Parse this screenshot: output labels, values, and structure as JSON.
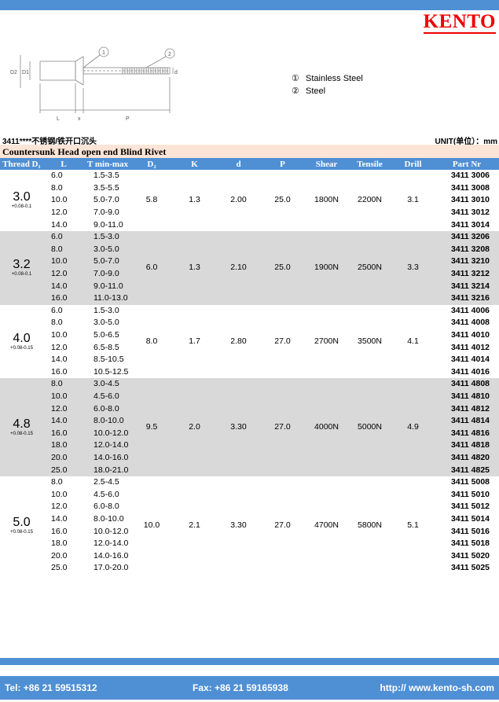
{
  "brand": "KENTO",
  "materials": [
    {
      "num": "①",
      "name": "Stainless Steel"
    },
    {
      "num": "②",
      "name": "Steel"
    }
  ],
  "drawing_labels": {
    "d2": "D2",
    "d1": "D1",
    "d": "d",
    "l": "L",
    "x": "x",
    "p": "P",
    "c1": "1",
    "c2": "2"
  },
  "product_line": "3411****不锈钢/铁开口沉头",
  "unit_label": "UNIT(单位）：mm",
  "subtitle": "Countersunk Head open end Blind Rivet",
  "headers": [
    "Thread D₁",
    "L",
    "T min-max",
    "D₂",
    "K",
    "d",
    "P",
    "Shear",
    "Tensile",
    "Drill",
    "Part Nr"
  ],
  "groups": [
    {
      "thread": "3.0",
      "tol": "+0.08-0.1",
      "d2": "5.8",
      "k": "1.3",
      "d": "2.00",
      "p": "25.0",
      "shear": "1800N",
      "tensile": "2200N",
      "drill": "3.1",
      "rows": [
        [
          "6.0",
          "1.5-3.5",
          "3411 3006"
        ],
        [
          "8.0",
          "3.5-5.5",
          "3411 3008"
        ],
        [
          "10.0",
          "5.0-7.0",
          "3411 3010"
        ],
        [
          "12.0",
          "7.0-9.0",
          "3411 3012"
        ],
        [
          "14.0",
          "9.0-11.0",
          "3411 3014"
        ]
      ]
    },
    {
      "thread": "3.2",
      "tol": "+0.08-0.1",
      "d2": "6.0",
      "k": "1.3",
      "d": "2.10",
      "p": "25.0",
      "shear": "1900N",
      "tensile": "2500N",
      "drill": "3.3",
      "rows": [
        [
          "6.0",
          "1.5-3.0",
          "3411 3206"
        ],
        [
          "8.0",
          "3.0-5.0",
          "3411 3208"
        ],
        [
          "10.0",
          "5.0-7.0",
          "3411 3210"
        ],
        [
          "12.0",
          "7.0-9.0",
          "3411 3212"
        ],
        [
          "14.0",
          "9.0-11.0",
          "3411 3214"
        ],
        [
          "16.0",
          "11.0-13.0",
          "3411 3216"
        ]
      ]
    },
    {
      "thread": "4.0",
      "tol": "+0.08-0.15",
      "d2": "8.0",
      "k": "1.7",
      "d": "2.80",
      "p": "27.0",
      "shear": "2700N",
      "tensile": "3500N",
      "drill": "4.1",
      "rows": [
        [
          "6.0",
          "1.5-3.0",
          "3411 4006"
        ],
        [
          "8.0",
          "3.0-5.0",
          "3411 4008"
        ],
        [
          "10.0",
          "5.0-6.5",
          "3411 4010"
        ],
        [
          "12.0",
          "6.5-8.5",
          "3411 4012"
        ],
        [
          "14.0",
          "8.5-10.5",
          "3411 4014"
        ],
        [
          "16.0",
          "10.5-12.5",
          "3411 4016"
        ]
      ]
    },
    {
      "thread": "4.8",
      "tol": "+0.08-0.15",
      "d2": "9.5",
      "k": "2.0",
      "d": "3.30",
      "p": "27.0",
      "shear": "4000N",
      "tensile": "5000N",
      "drill": "4.9",
      "rows": [
        [
          "8.0",
          "3.0-4.5",
          "3411 4808"
        ],
        [
          "10.0",
          "4.5-6.0",
          "3411 4810"
        ],
        [
          "12.0",
          "6.0-8.0",
          "3411 4812"
        ],
        [
          "14.0",
          "8.0-10.0",
          "3411 4814"
        ],
        [
          "16.0",
          "10.0-12.0",
          "3411 4816"
        ],
        [
          "18.0",
          "12.0-14.0",
          "3411 4818"
        ],
        [
          "20.0",
          "14.0-16.0",
          "3411 4820"
        ],
        [
          "25.0",
          "18.0-21.0",
          "3411 4825"
        ]
      ]
    },
    {
      "thread": "5.0",
      "tol": "+0.08-0.15",
      "d2": "10.0",
      "k": "2.1",
      "d": "3.30",
      "p": "27.0",
      "shear": "4700N",
      "tensile": "5800N",
      "drill": "5.1",
      "rows": [
        [
          "8.0",
          "2.5-4.5",
          "3411 5008"
        ],
        [
          "10.0",
          "4.5-6.0",
          "3411 5010"
        ],
        [
          "12.0",
          "6.0-8.0",
          "3411 5012"
        ],
        [
          "14.0",
          "8.0-10.0",
          "3411 5014"
        ],
        [
          "16.0",
          "10.0-12.0",
          "3411 5016"
        ],
        [
          "18.0",
          "12.0-14.0",
          "3411 5018"
        ],
        [
          "20.0",
          "14.0-16.0",
          "3411 5020"
        ],
        [
          "25.0",
          "17.0-20.0",
          "3411 5025"
        ]
      ]
    }
  ],
  "footer": {
    "tel": "Tel: +86 21 59515312",
    "fax": "Fax: +86 21 59165938",
    "web": "http:// www.kento-sh.com"
  },
  "colors": {
    "bar": "#4f8fd4",
    "logo": "#ee0000",
    "alt_row": "#d9d9d9",
    "subtitle_bg": "#fce4d6"
  }
}
